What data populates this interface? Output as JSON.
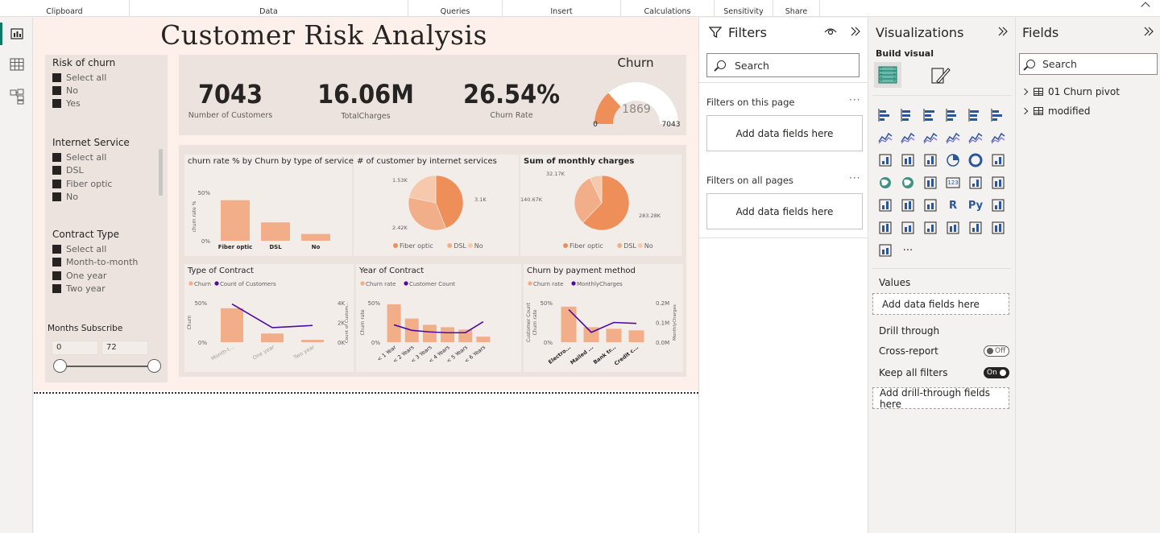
{
  "ribbon": {
    "groups": [
      {
        "label": "Clipboard"
      },
      {
        "label": "Data"
      },
      {
        "label": "Queries"
      },
      {
        "label": "Insert"
      },
      {
        "label": "Calculations"
      },
      {
        "label": "Sensitivity"
      },
      {
        "label": "Share"
      }
    ]
  },
  "nav": {
    "items": [
      "report-view-icon",
      "table-view-icon",
      "model-view-icon"
    ]
  },
  "report": {
    "title": "Customer Risk Analysis",
    "slicers": [
      {
        "title": "Risk of churn",
        "items": [
          "Select all",
          "No",
          "Yes"
        ]
      },
      {
        "title": "Internet Service",
        "items": [
          "Select all",
          "DSL",
          "Fiber optic",
          "No"
        ]
      },
      {
        "title": "Contract Type",
        "items": [
          "Select all",
          "Month-to-month",
          "One year",
          "Two year"
        ]
      }
    ],
    "months": {
      "title": "Months Subscribe",
      "min": "0",
      "max": "72"
    },
    "kpis": [
      {
        "value": "7043",
        "label": "Number of Customers"
      },
      {
        "value": "16.06M",
        "label": "TotalCharges"
      },
      {
        "value": "26.54%",
        "label": "Churn Rate"
      }
    ],
    "gauge": {
      "title": "Churn",
      "value": "1869",
      "min": "0",
      "max": "7043",
      "fraction": 0.2654
    },
    "colors": {
      "primary": "#ee8f5a",
      "light": "#f2ae89",
      "lighter": "#f6c9ad",
      "line": "#4b0ca3",
      "bg": "#f3ede9"
    }
  },
  "chart_data": [
    {
      "type": "bar",
      "title": "churn rate % by Churn by type of service",
      "categories": [
        "Fiber optic",
        "DSL",
        "No"
      ],
      "values": [
        42,
        19,
        7
      ],
      "ylabel": "churn rate %",
      "yticks": [
        "50%",
        "0%"
      ],
      "ylim": [
        0,
        50
      ]
    },
    {
      "type": "pie",
      "title": "# of customer by internet services",
      "labels": [
        "Fiber optic",
        "DSL",
        "No"
      ],
      "values": [
        3.1,
        2.42,
        1.53
      ],
      "data_labels": [
        "3.1K",
        "2.42K",
        "1.53K"
      ]
    },
    {
      "type": "pie",
      "title": "Sum of monthly charges",
      "labels": [
        "Fiber optic",
        "DSL",
        "No"
      ],
      "values": [
        283.28,
        140.67,
        32.17
      ],
      "data_labels": [
        "283.28K",
        "140.67K",
        "32.17K"
      ]
    },
    {
      "type": "bar",
      "title": "Type of Contract",
      "legend": [
        "Churn",
        "Count of Customers"
      ],
      "categories": [
        "Month-t...",
        "One year",
        "Two year"
      ],
      "bar_values": [
        43,
        11,
        3
      ],
      "line_values": [
        3875,
        1473,
        1695
      ],
      "ylabel": "Churn",
      "y2label": "Count of Custom...",
      "yticks": [
        "50%",
        "0%"
      ],
      "y2ticks": [
        "4K",
        "2K",
        "0K"
      ],
      "ylim": [
        0,
        50
      ],
      "y2lim": [
        0,
        4000
      ]
    },
    {
      "type": "bar",
      "title": "Year of Contract",
      "legend": [
        "Churn rate",
        "Customer Count"
      ],
      "categories": [
        "< 1 Year",
        "< 2 Years",
        "< 3 Years",
        "< 4 Years",
        "< 5 Years",
        "< 6 Years"
      ],
      "bar_values": [
        48,
        30,
        22,
        19,
        16,
        7
      ],
      "line_values": [
        22,
        15,
        13,
        12,
        12,
        26
      ],
      "ylabel": "Churn rate",
      "yticks": [
        "50%",
        "0%"
      ],
      "ylim": [
        0,
        50
      ]
    },
    {
      "type": "bar",
      "title": "Churn by payment method",
      "legend": [
        "Churn rate",
        "MonthlyCharges"
      ],
      "categories": [
        "Electro...",
        "Mailed ...",
        "Bank tr...",
        "Credit c..."
      ],
      "bar_values": [
        45,
        19,
        17,
        15
      ],
      "line_values": [
        0.165,
        0.05,
        0.1,
        0.095
      ],
      "ylabel": "Churn rate",
      "ylabel2": "Customer Count",
      "y2label": "MonthlyCharges",
      "yticks": [
        "50%",
        "0%"
      ],
      "y2ticks": [
        "0.2M",
        "0.1M",
        "0.0M"
      ],
      "ylim": [
        0,
        50
      ],
      "y2lim": [
        0,
        0.2
      ]
    }
  ],
  "filters": {
    "title": "Filters",
    "search_placeholder": "Search",
    "on_this_page": "Filters on this page",
    "on_all_pages": "Filters on all pages",
    "drop_label": "Add data fields here",
    "more": "···"
  },
  "visualizations": {
    "title": "Visualizations",
    "build_visual": "Build visual",
    "values_label": "Values",
    "values_drop": "Add data fields here",
    "drill_through": "Drill through",
    "cross_report": "Cross-report",
    "cross_report_state": "Off",
    "keep_all_filters": "Keep all filters",
    "keep_all_filters_state": "On",
    "drill_drop": "Add drill-through fields here",
    "more": "···",
    "icon_text": {
      "r": "R",
      "py": "Py",
      "num": "123"
    }
  },
  "fields": {
    "title": "Fields",
    "search_placeholder": "Search",
    "tables": [
      "01 Churn pivot",
      "modified"
    ]
  }
}
